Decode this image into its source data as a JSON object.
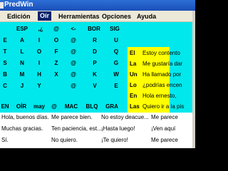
{
  "window": {
    "title": "PredWin"
  },
  "menu": [
    "Edición",
    "Oír",
    "Herramientas",
    "Opciones",
    "Ayuda"
  ],
  "menu_selected": "Oír",
  "keyboard": {
    "row1": [
      "ESP",
      ",¿",
      "@",
      "<-",
      "BOR",
      "SIG"
    ],
    "row2": [
      "E",
      "A",
      "I",
      "O",
      "@",
      "R",
      "U"
    ],
    "row3": [
      "T",
      "L",
      "O",
      "F",
      "@",
      "D",
      "Q"
    ],
    "row4": [
      "S",
      "N",
      "I",
      "Z",
      "@",
      "P",
      "G"
    ],
    "row5": [
      "B",
      "M",
      "H",
      "X",
      "@",
      "K",
      "W"
    ],
    "row6": [
      "C",
      "J",
      "Y",
      "@",
      "V",
      "E"
    ],
    "row7": [
      "EN",
      "OÍR",
      "may",
      "@",
      "MAC",
      "BLQ",
      "GRA",
      "GraFich",
      "Su",
      "Esta"
    ]
  },
  "word_column": [
    "El",
    "La",
    "Un",
    "Lo",
    "En",
    "Las"
  ],
  "phrase_column": [
    "Estoy contento",
    "Me gustaría dar",
    "Ha llamado por",
    "¿podrías encen",
    "Hola ernesto,",
    "Quiero ir a la pis"
  ],
  "phrases_bottom": [
    [
      "Hola, buenos días.",
      "Me parece bien.",
      "No estoy deacue...",
      "Me parece"
    ],
    [
      "Muchas gracias.",
      "Ten paciencia, est...",
      "¡Hasta luego!",
      "¡Ven aquí"
    ],
    [
      "Sí.",
      "No quiero.",
      "¡Te quiero!",
      "Me parece"
    ]
  ]
}
